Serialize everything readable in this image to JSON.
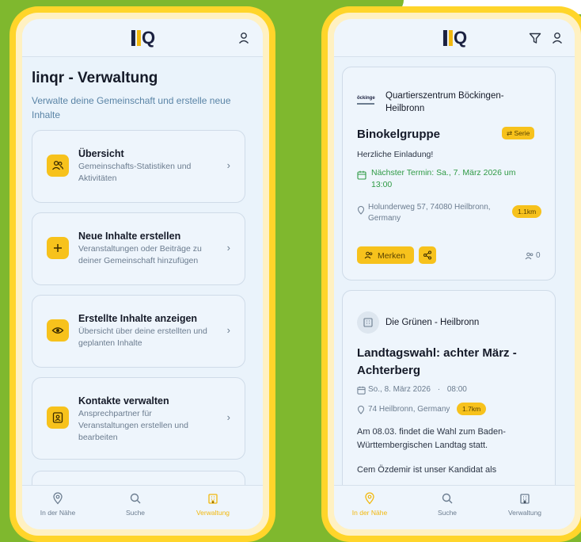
{
  "left_screen": {
    "page_title": "linqr - Verwaltung",
    "page_subtitle": "Verwalte deine Gemeinschaft und erstelle neue Inhalte",
    "menu": [
      {
        "icon": "users-icon",
        "title": "Übersicht",
        "description": "Gemeinschafts-Statistiken und Aktivitäten"
      },
      {
        "icon": "plus-icon",
        "title": "Neue Inhalte erstellen",
        "description": "Veranstaltungen oder Beiträge zu deiner Gemeinschaft hinzufügen"
      },
      {
        "icon": "eye-icon",
        "title": "Erstellte Inhalte anzeigen",
        "description": "Übersicht über deine erstellten und geplanten Inhalte"
      },
      {
        "icon": "contact-card-icon",
        "title": "Kontakte verwalten",
        "description": "Ansprechpartner für Veranstaltungen erstellen und bearbeiten"
      }
    ],
    "chevron": "›"
  },
  "right_screen": {
    "event1": {
      "org_logo_text": "öckinge",
      "org_name": "Quartierszentrum Böckingen-Heilbronn",
      "title": "Binokelgruppe",
      "series_badge": "Serie",
      "tagline": "Herzliche Einladung!",
      "next_date": "Nächster Termin: Sa., 7. März 2026 um 13:00",
      "address": "Holunderweg 57, 74080 Heilbronn, Germany",
      "distance": "1.1km",
      "merken_label": "Merken",
      "attendees": "0"
    },
    "event2": {
      "org_name": "Die Grünen - Heilbronn",
      "title": "Landtagswahl: achter März - Achterberg",
      "date": "So., 8. März 2026",
      "separator": "·",
      "time": "08:00",
      "address": "74 Heilbronn, Germany",
      "distance": "1.7km",
      "description": "Am 08.03. findet die Wahl zum Baden-Württembergischen Landtag statt.",
      "description_cut": "Cem Özdemir ist unser Kandidat als"
    }
  },
  "bottom_nav": {
    "items": [
      {
        "label": "In der Nähe",
        "icon": "location-pin-icon"
      },
      {
        "label": "Suche",
        "icon": "search-icon"
      },
      {
        "label": "Verwaltung",
        "icon": "building-icon"
      }
    ],
    "active_left": "Verwaltung",
    "active_right": "In der Nähe"
  },
  "colors": {
    "background": "#7fb82e",
    "phone_frame": "#ffd52a",
    "accent": "#f7c21c",
    "screen": "#eaf3fb",
    "green_text": "#2f9a45"
  }
}
